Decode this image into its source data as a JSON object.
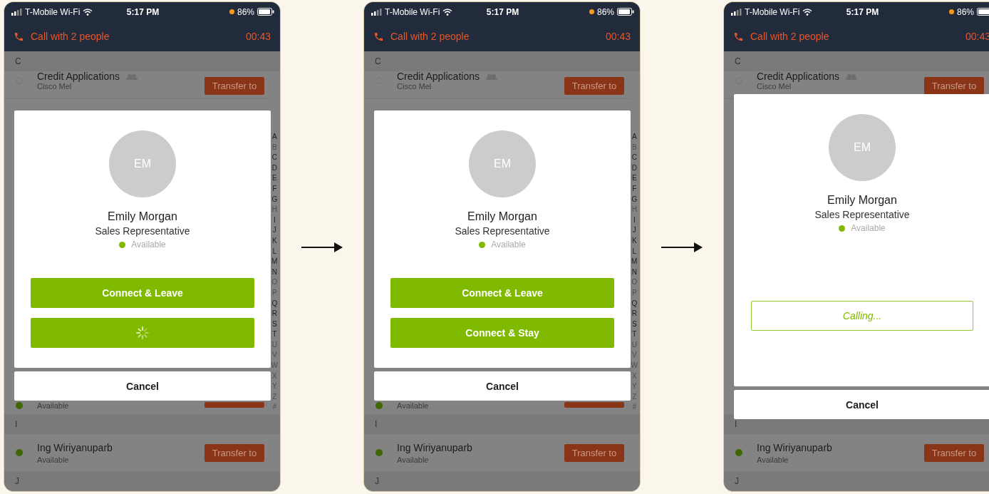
{
  "phones": [
    {
      "status_bar": {
        "carrier": "T-Mobile Wi-Fi",
        "time": "5:17 PM",
        "battery": "86%"
      },
      "call_bar": {
        "title": "Call with 2 people",
        "timer": "00:43"
      },
      "list": [
        {
          "kind": "header",
          "letter": "C"
        },
        {
          "kind": "contact",
          "name": "Credit Applications",
          "subtitle": "Cisco Mel",
          "online": false,
          "group": true,
          "action": "Transfer to"
        },
        {
          "kind": "gap"
        },
        {
          "kind": "contact",
          "subtitle": "Available",
          "online": true
        },
        {
          "kind": "header",
          "letter": "I"
        },
        {
          "kind": "contact",
          "name": "Ing Wiriyanuparb",
          "subtitle": "Available",
          "online": true,
          "action": "Transfer to"
        },
        {
          "kind": "header",
          "letter": "J"
        }
      ],
      "index": [
        {
          "letter": "A",
          "enabled": true
        },
        {
          "letter": "B",
          "enabled": false
        },
        {
          "letter": "C",
          "enabled": true
        },
        {
          "letter": "D",
          "enabled": true
        },
        {
          "letter": "E",
          "enabled": true
        },
        {
          "letter": "F",
          "enabled": true
        },
        {
          "letter": "G",
          "enabled": true
        },
        {
          "letter": "H",
          "enabled": false
        },
        {
          "letter": "I",
          "enabled": true
        },
        {
          "letter": "J",
          "enabled": true
        },
        {
          "letter": "K",
          "enabled": true
        },
        {
          "letter": "L",
          "enabled": true
        },
        {
          "letter": "M",
          "enabled": true
        },
        {
          "letter": "N",
          "enabled": true
        },
        {
          "letter": "O",
          "enabled": false
        },
        {
          "letter": "P",
          "enabled": false
        },
        {
          "letter": "Q",
          "enabled": true
        },
        {
          "letter": "R",
          "enabled": true
        },
        {
          "letter": "S",
          "enabled": true
        },
        {
          "letter": "T",
          "enabled": true
        },
        {
          "letter": "U",
          "enabled": false
        },
        {
          "letter": "V",
          "enabled": false
        },
        {
          "letter": "W",
          "enabled": false
        },
        {
          "letter": "X",
          "enabled": false
        },
        {
          "letter": "Y",
          "enabled": false
        },
        {
          "letter": "Z",
          "enabled": false
        },
        {
          "letter": "#",
          "enabled": false
        }
      ],
      "dialog": {
        "kind": "choice",
        "initials": "EM",
        "name": "Emily Morgan",
        "role": "Sales Representative",
        "status": "Available",
        "actions": [
          {
            "kind": "label",
            "label": "Connect & Leave"
          },
          {
            "kind": "spinner"
          }
        ],
        "cancel": "Cancel"
      }
    },
    {
      "status_bar": {
        "carrier": "T-Mobile Wi-Fi",
        "time": "5:17 PM",
        "battery": "86%"
      },
      "call_bar": {
        "title": "Call with 2 people",
        "timer": "00:43"
      },
      "list": [
        {
          "kind": "header",
          "letter": "C"
        },
        {
          "kind": "contact",
          "name": "Credit Applications",
          "subtitle": "Cisco Mel",
          "online": false,
          "group": true,
          "action": "Transfer to"
        },
        {
          "kind": "gap"
        },
        {
          "kind": "contact",
          "subtitle": "Available",
          "online": true
        },
        {
          "kind": "header",
          "letter": "I"
        },
        {
          "kind": "contact",
          "name": "Ing Wiriyanuparb",
          "subtitle": "Available",
          "online": true,
          "action": "Transfer to"
        },
        {
          "kind": "header",
          "letter": "J"
        }
      ],
      "index": [
        {
          "letter": "A",
          "enabled": true
        },
        {
          "letter": "B",
          "enabled": false
        },
        {
          "letter": "C",
          "enabled": true
        },
        {
          "letter": "D",
          "enabled": true
        },
        {
          "letter": "E",
          "enabled": true
        },
        {
          "letter": "F",
          "enabled": true
        },
        {
          "letter": "G",
          "enabled": true
        },
        {
          "letter": "H",
          "enabled": false
        },
        {
          "letter": "I",
          "enabled": true
        },
        {
          "letter": "J",
          "enabled": true
        },
        {
          "letter": "K",
          "enabled": true
        },
        {
          "letter": "L",
          "enabled": true
        },
        {
          "letter": "M",
          "enabled": true
        },
        {
          "letter": "N",
          "enabled": true
        },
        {
          "letter": "O",
          "enabled": false
        },
        {
          "letter": "P",
          "enabled": false
        },
        {
          "letter": "Q",
          "enabled": true
        },
        {
          "letter": "R",
          "enabled": true
        },
        {
          "letter": "S",
          "enabled": true
        },
        {
          "letter": "T",
          "enabled": true
        },
        {
          "letter": "U",
          "enabled": false
        },
        {
          "letter": "V",
          "enabled": false
        },
        {
          "letter": "W",
          "enabled": false
        },
        {
          "letter": "X",
          "enabled": false
        },
        {
          "letter": "Y",
          "enabled": false
        },
        {
          "letter": "Z",
          "enabled": false
        },
        {
          "letter": "#",
          "enabled": false
        }
      ],
      "dialog": {
        "kind": "choice",
        "initials": "EM",
        "name": "Emily Morgan",
        "role": "Sales Representative",
        "status": "Available",
        "actions": [
          {
            "kind": "label",
            "label": "Connect & Leave"
          },
          {
            "kind": "label",
            "label": "Connect & Stay"
          }
        ],
        "cancel": "Cancel"
      }
    },
    {
      "status_bar": {
        "carrier": "T-Mobile Wi-Fi",
        "time": "5:17 PM",
        "battery": "86%"
      },
      "call_bar": {
        "title": "Call with 2 people",
        "timer": "00:43"
      },
      "list": [
        {
          "kind": "header",
          "letter": "C"
        },
        {
          "kind": "contact",
          "name": "Credit Applications",
          "subtitle": "Cisco Mel",
          "online": false,
          "group": true,
          "action": "Transfer to"
        },
        {
          "kind": "gap"
        },
        {
          "kind": "gap"
        },
        {
          "kind": "header",
          "letter": "I"
        },
        {
          "kind": "contact",
          "name": "Ing Wiriyanuparb",
          "subtitle": "Available",
          "online": true,
          "action": "Transfer to"
        },
        {
          "kind": "header",
          "letter": "J"
        }
      ],
      "dialog": {
        "kind": "calling",
        "initials": "EM",
        "name": "Emily Morgan",
        "role": "Sales Representative",
        "status": "Available",
        "actions": [
          {
            "kind": "outline",
            "label": "Calling..."
          }
        ],
        "cancel": "Cancel"
      }
    }
  ]
}
